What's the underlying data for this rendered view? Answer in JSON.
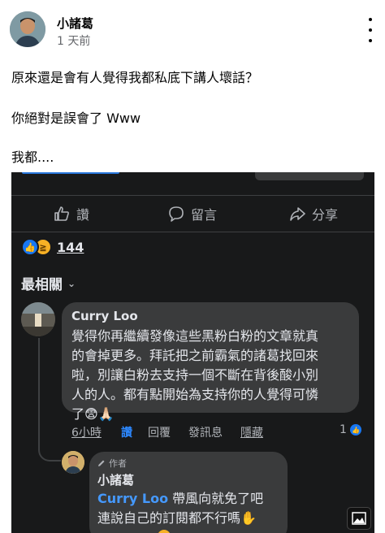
{
  "post": {
    "author": "小諸葛",
    "time": "1 天前",
    "lines": [
      "原來還是會有人覺得我都私底下講人壞話？",
      "你絕對是誤會了 Www",
      "我都...."
    ]
  },
  "screenshot": {
    "actions": [
      {
        "icon": "thumbs-up-icon",
        "label": "讚"
      },
      {
        "icon": "comment-icon",
        "label": "留言"
      },
      {
        "icon": "share-icon",
        "label": "分享"
      }
    ],
    "reactions": {
      "icons": [
        "like-icon",
        "haha-icon"
      ],
      "count": "144"
    },
    "sort_label": "最相關",
    "comment": {
      "author": "Curry Loo",
      "lines": [
        "覺得你再繼續發像這些黑粉白粉的文章就真",
        "的會掉更多。拜託把之前霸氣的諸葛找回來",
        "啦，別讓白粉去支持一個不斷在背後酸小別",
        "人的人。都有點開始為支持你的人覺得可憐"
      ],
      "last_line": "了",
      "emojis": "😨🙏🏻",
      "time": "6小時",
      "like": "讚",
      "reply": "回覆",
      "message": "發訊息",
      "hide": "隱藏",
      "like_count": "1"
    },
    "reply": {
      "author_badge": "作者",
      "author": "小諸葛",
      "mention": "Curry Loo",
      "line1_rest": " 帶風向就免了吧",
      "line2": "連說自己的訂閱都不行嗎",
      "line2_emoji": "✋"
    }
  }
}
